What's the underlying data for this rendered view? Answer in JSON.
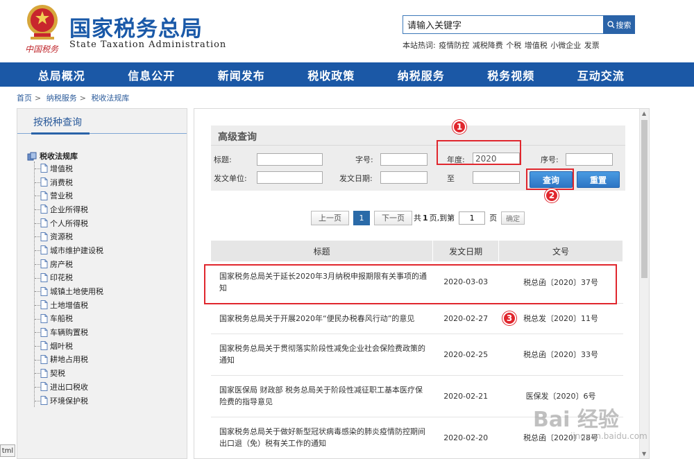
{
  "header": {
    "site_title": "国家税务总局",
    "site_title_en": "State Taxation Administration",
    "brand_sub": "中国税务",
    "search_placeholder": "请输入关键字",
    "search_button": "搜索",
    "hot_label": "本站热词:",
    "hot_words": [
      "疫情防控",
      "减税降费",
      "个税",
      "增值税",
      "小微企业",
      "发票"
    ]
  },
  "nav": [
    "总局概况",
    "信息公开",
    "新闻发布",
    "税收政策",
    "纳税服务",
    "税务视频",
    "互动交流"
  ],
  "breadcrumb": [
    "首页",
    "纳税服务",
    "税收法规库"
  ],
  "sidebar": {
    "heading": "按税种查询",
    "root": "税收法规库",
    "items": [
      "增值税",
      "消费税",
      "营业税",
      "企业所得税",
      "个人所得税",
      "资源税",
      "城市维护建设税",
      "房产税",
      "印花税",
      "城镇土地使用税",
      "土地增值税",
      "车船税",
      "车辆购置税",
      "烟叶税",
      "耕地占用税",
      "契税",
      "进出口税收",
      "环境保护税"
    ]
  },
  "search_form": {
    "title": "高级查询",
    "labels": {
      "title": "标题:",
      "doc_no": "字号:",
      "year": "年度:",
      "seq": "序号:",
      "issuer": "发文单位:",
      "date": "发文日期:",
      "to": "至"
    },
    "values": {
      "year": "2020"
    },
    "query_button": "查询",
    "reset_button": "重置"
  },
  "pager": {
    "prev": "上一页",
    "current": "1",
    "next": "下一页",
    "total_prefix": "共",
    "total_pages": "1",
    "total_suffix": "页,到第",
    "goto_value": "1",
    "page_suffix": "页",
    "confirm": "确定"
  },
  "results": {
    "headers": [
      "标题",
      "发文日期",
      "文号"
    ],
    "rows": [
      {
        "title": "国家税务总局关于延长2020年3月纳税申报期限有关事项的通知",
        "date": "2020-03-03",
        "doc_no": "税总函〔2020〕37号"
      },
      {
        "title": "国家税务总局关于开展2020年“便民办税春风行动”的意见",
        "date": "2020-02-27",
        "doc_no": "税总发〔2020〕11号"
      },
      {
        "title": "国家税务总局关于贯彻落实阶段性减免企业社会保险费政策的通知",
        "date": "2020-02-25",
        "doc_no": "税总函〔2020〕33号"
      },
      {
        "title": "国家医保局 财政部 税务总局关于阶段性减征职工基本医疗保险费的指导意见",
        "date": "2020-02-21",
        "doc_no": "医保发〔2020〕6号"
      },
      {
        "title": "国家税务总局关于做好新型冠状病毒感染的肺炎疫情防控期间出口退（免）税有关工作的通知",
        "date": "2020-02-20",
        "doc_no": "税总函〔2020〕28号"
      }
    ]
  },
  "annotations": [
    "1",
    "2",
    "3"
  ],
  "watermark": {
    "main": "Bai 经验",
    "sub": "jingyan.baidu.com"
  },
  "corner_tag": "tml",
  "colors": {
    "brand_blue": "#1b58a6",
    "highlight_red": "#e0262d"
  }
}
